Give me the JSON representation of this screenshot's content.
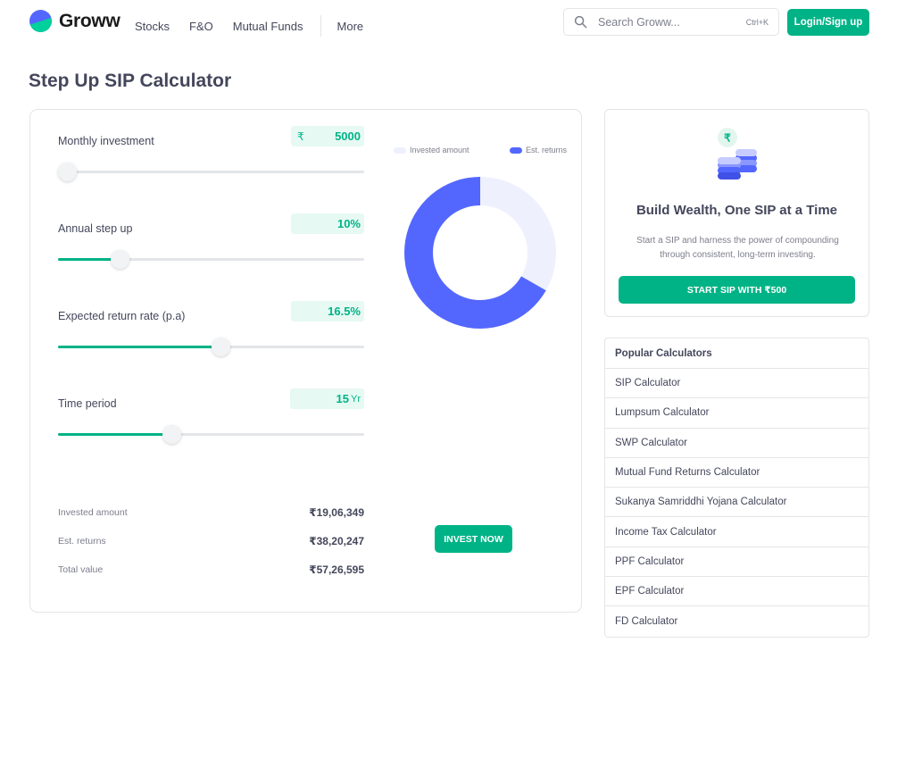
{
  "brand": {
    "name": "Groww"
  },
  "nav": {
    "items": [
      "Stocks",
      "F&O",
      "Mutual Funds"
    ],
    "more": "More"
  },
  "search": {
    "placeholder": "Search Groww...",
    "shortcut": "Ctrl+K"
  },
  "login_label": "Login/Sign up",
  "page": {
    "title": "Step Up SIP Calculator"
  },
  "calculator": {
    "inputs": [
      {
        "label": "Monthly investment",
        "prefix": "₹",
        "value": "5000",
        "unit": "",
        "slider_fraction": 0.03
      },
      {
        "label": "Annual step up",
        "prefix": "",
        "value": "10%",
        "unit": "",
        "slider_fraction": 0.2
      },
      {
        "label": "Expected return rate (p.a)",
        "prefix": "",
        "value": "16.5%",
        "unit": "",
        "slider_fraction": 0.53
      },
      {
        "label": "Time period",
        "prefix": "",
        "value": "15",
        "unit": "Yr",
        "slider_fraction": 0.37
      }
    ],
    "legend": {
      "invested": "Invested amount",
      "returns": "Est. returns"
    },
    "summary": [
      {
        "label": "Invested amount",
        "value": "₹19,06,349"
      },
      {
        "label": "Est. returns",
        "value": "₹38,20,247"
      },
      {
        "label": "Total value",
        "value": "₹57,26,595"
      }
    ],
    "invest_button": "INVEST NOW"
  },
  "chart_data": {
    "type": "pie",
    "categories": [
      "Invested amount",
      "Est. returns"
    ],
    "values": [
      1906349,
      3820247
    ],
    "donut": true,
    "legend": "top"
  },
  "promo": {
    "title": "Build Wealth, One SIP at a Time",
    "description": "Start a SIP and harness the power of compounding through consistent, long-term investing.",
    "button": "START SIP WITH ₹500",
    "badge": "₹"
  },
  "popular": {
    "title": "Popular Calculators",
    "items": [
      "SIP Calculator",
      "Lumpsum Calculator",
      "SWP Calculator",
      "Mutual Fund Returns Calculator",
      "Sukanya Samriddhi Yojana Calculator",
      "Income Tax Calculator",
      "PPF Calculator",
      "EPF Calculator",
      "FD Calculator"
    ]
  },
  "colors": {
    "accent": "#00b386",
    "invested": "#eef0fd",
    "returns": "#5367ff",
    "text": "#44475b"
  }
}
